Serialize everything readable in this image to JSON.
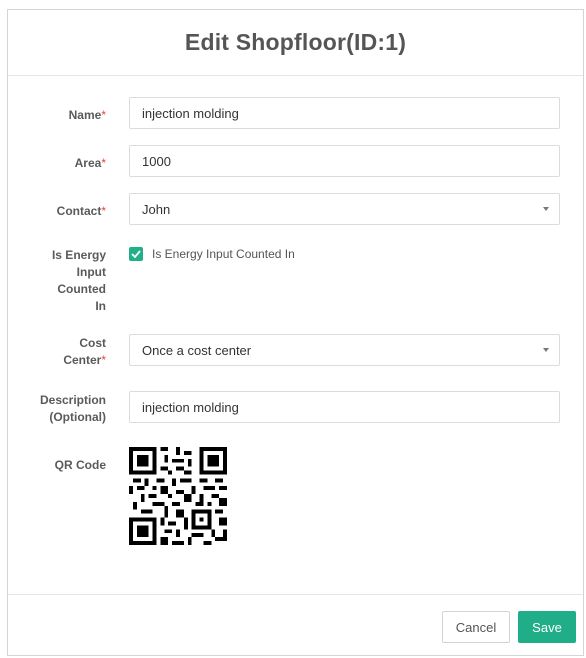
{
  "modal": {
    "title": "Edit Shopfloor(ID:1)"
  },
  "form": {
    "name": {
      "label": "Name",
      "required_mark": "*",
      "value": "injection molding"
    },
    "area": {
      "label": "Area",
      "required_mark": "*",
      "value": "1000"
    },
    "contact": {
      "label": "Contact",
      "required_mark": "*",
      "value": "John"
    },
    "energy": {
      "label_lines": [
        "Is Energy",
        "Input",
        "Counted",
        "In"
      ],
      "checkbox_label": "Is Energy Input Counted In",
      "checked": true
    },
    "cost_center": {
      "label_line1": "Cost",
      "label_line2": "Center",
      "required_mark": "*",
      "value": "Once a cost center"
    },
    "description": {
      "label_line1": "Description",
      "label_line2": "(Optional)",
      "value": "injection molding"
    },
    "qr": {
      "label": "QR Code"
    }
  },
  "footer": {
    "cancel_label": "Cancel",
    "save_label": "Save"
  },
  "colors": {
    "accent": "#20ae88",
    "required": "#e2453f"
  }
}
